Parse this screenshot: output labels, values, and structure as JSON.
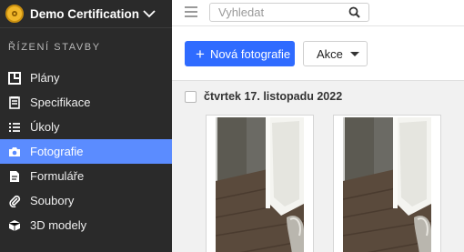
{
  "sidebar": {
    "org_name": "Demo Certification",
    "section_label": "ŘÍZENÍ STAVBY",
    "items": [
      {
        "label": "Plány",
        "icon": "floorplan-icon",
        "active": false
      },
      {
        "label": "Specifikace",
        "icon": "specification-icon",
        "active": false
      },
      {
        "label": "Úkoly",
        "icon": "task-list-icon",
        "active": false
      },
      {
        "label": "Fotografie",
        "icon": "camera-icon",
        "active": true
      },
      {
        "label": "Formuláře",
        "icon": "form-icon",
        "active": false
      },
      {
        "label": "Soubory",
        "icon": "paperclip-icon",
        "active": false
      },
      {
        "label": "3D modely",
        "icon": "cube-icon",
        "active": false
      }
    ]
  },
  "header": {
    "search_placeholder": "Vyhledat"
  },
  "toolbar": {
    "new_photo_label": "Nová fotografie",
    "actions_label": "Akce"
  },
  "content": {
    "date_group_label": "čtvrtek 17. listopadu 2022",
    "photos": [
      {
        "kind": "room-photo"
      },
      {
        "kind": "room-photo"
      }
    ]
  },
  "colors": {
    "sidebar_bg": "#2a2a2a",
    "accent": "#2f6bff",
    "active_nav": "#5b8cff",
    "logo": "#f1b72a"
  }
}
